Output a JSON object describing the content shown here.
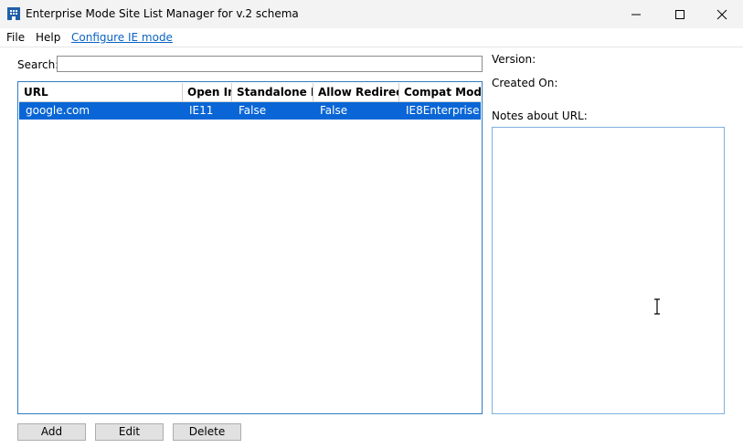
{
  "window": {
    "title": "Enterprise Mode Site List Manager for v.2 schema",
    "app_icon": "building-icon",
    "controls": [
      "minimize-icon",
      "maximize-icon",
      "close-icon"
    ]
  },
  "menu": {
    "file": "File",
    "help": "Help",
    "configure": "Configure IE mode"
  },
  "search": {
    "label": "Search:",
    "value": ""
  },
  "table": {
    "columns": [
      "URL",
      "Open In",
      "Standalone IE",
      "Allow Redirect",
      "Compat Mode"
    ],
    "rows": [
      {
        "url": "google.com",
        "open_in": "IE11",
        "standalone_ie": "False",
        "allow_redirect": "False",
        "compat_mode": "IE8Enterprise",
        "selected": true
      }
    ]
  },
  "details": {
    "version_label": "Version:",
    "created_label": "Created On:",
    "notes_label": "Notes about URL:",
    "notes_value": ""
  },
  "buttons": {
    "add": "Add",
    "edit": "Edit",
    "delete": "Delete"
  },
  "colors": {
    "selection": "#0a66d6",
    "link": "#0b63c4",
    "border_accent": "#2f7cc1"
  }
}
